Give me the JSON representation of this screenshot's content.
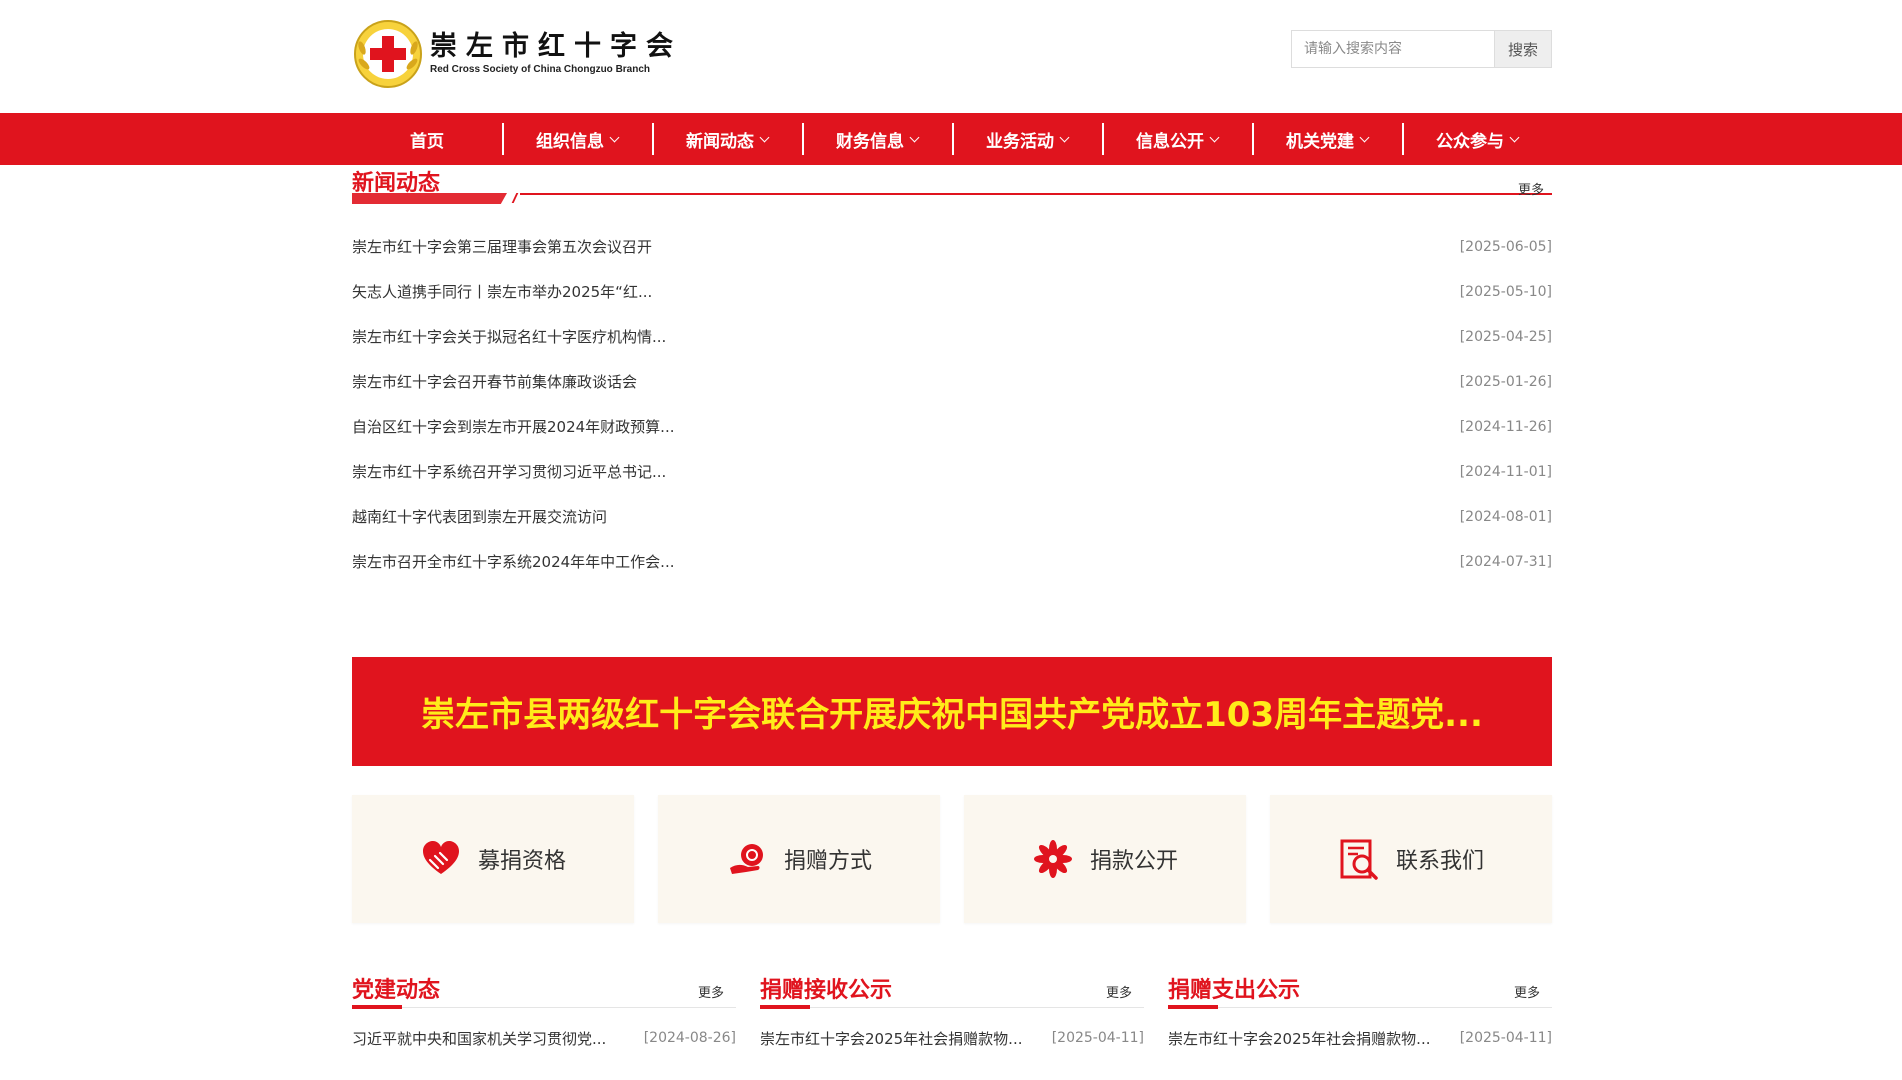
{
  "header": {
    "logo_cn": "崇左市红十字会",
    "logo_en": "Red Cross Society of China Chongzuo Branch",
    "search_placeholder": "请输入搜索内容",
    "search_button": "搜索"
  },
  "colors": {
    "brand_red": "#e0141e",
    "banner_text": "#ffec1a",
    "card_bg": "#fbf7ef"
  },
  "nav": {
    "items": [
      {
        "label": "首页",
        "dropdown": false
      },
      {
        "label": "组织信息",
        "dropdown": true
      },
      {
        "label": "新闻动态",
        "dropdown": true
      },
      {
        "label": "财务信息",
        "dropdown": true
      },
      {
        "label": "业务活动",
        "dropdown": true
      },
      {
        "label": "信息公开",
        "dropdown": true
      },
      {
        "label": "机关党建",
        "dropdown": true
      },
      {
        "label": "公众参与",
        "dropdown": true
      }
    ]
  },
  "news": {
    "title": "新闻动态",
    "more": "更多",
    "items": [
      {
        "title": "崇左市红十字会第三届理事会第五次会议召开",
        "date": "[2025-06-05]"
      },
      {
        "title": "矢志人道携手同行丨崇左市举办2025年“红...",
        "date": "[2025-05-10]"
      },
      {
        "title": "崇左市红十字会关于拟冠名红十字医疗机构情...",
        "date": "[2025-04-25]"
      },
      {
        "title": "崇左市红十字会召开春节前集体廉政谈话会",
        "date": "[2025-01-26]"
      },
      {
        "title": "自治区红十字会到崇左市开展2024年财政预算...",
        "date": "[2024-11-26]"
      },
      {
        "title": "崇左市红十字系统召开学习贯彻习近平总书记...",
        "date": "[2024-11-01]"
      },
      {
        "title": "越南红十字代表团到崇左开展交流访问",
        "date": "[2024-08-01]"
      },
      {
        "title": "崇左市召开全市红十字系统2024年年中工作会...",
        "date": "[2024-07-31]"
      }
    ]
  },
  "banner": {
    "text": "崇左市县两级红十字会联合开展庆祝中国共产党成立103周年主题党..."
  },
  "quick_links": [
    {
      "label": "募捐资格",
      "icon": "heart-hand-icon"
    },
    {
      "label": "捐赠方式",
      "icon": "donate-hand-icon"
    },
    {
      "label": "捐款公开",
      "icon": "flower-icon"
    },
    {
      "label": "联系我们",
      "icon": "document-search-icon"
    }
  ],
  "columns": [
    {
      "title": "党建动态",
      "more": "更多",
      "items": [
        {
          "title": "习近平就中央和国家机关学习贯彻党...",
          "date": "[2024-08-26]"
        }
      ]
    },
    {
      "title": "捐赠接收公示",
      "more": "更多",
      "items": [
        {
          "title": "崇左市红十字会2025年社会捐赠款物...",
          "date": "[2025-04-11]"
        }
      ]
    },
    {
      "title": "捐赠支出公示",
      "more": "更多",
      "items": [
        {
          "title": "崇左市红十字会2025年社会捐赠款物...",
          "date": "[2025-04-11]"
        }
      ]
    }
  ]
}
